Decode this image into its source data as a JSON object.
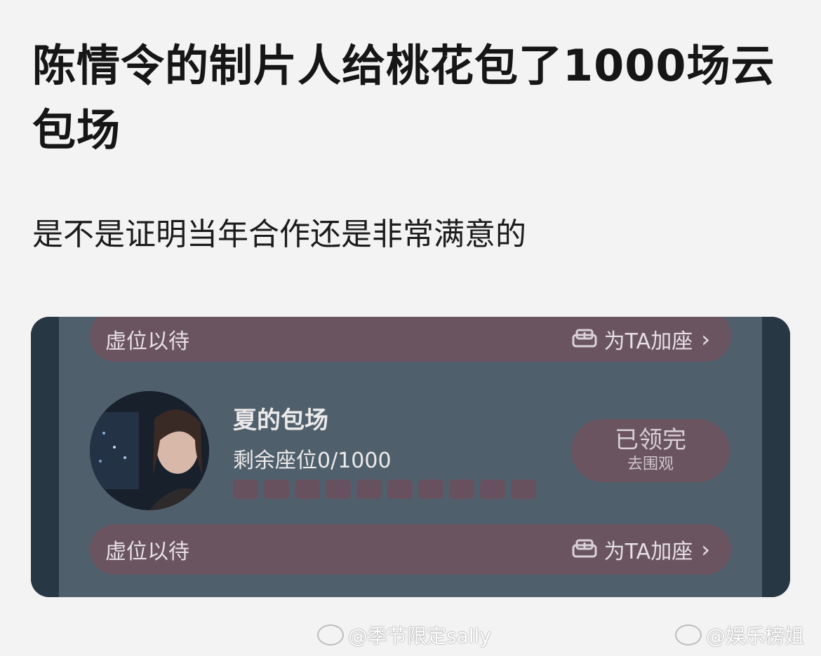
{
  "post": {
    "title": "陈情令的制片人给桃花包了1000场云包场",
    "body": "是不是证明当年合作还是非常满意的"
  },
  "card": {
    "top_row": {
      "label": "虚位以待",
      "action": "为TA加座"
    },
    "room": {
      "name": "夏的包场",
      "seats": "剩余座位0/1000",
      "seat_slots_shown": 10
    },
    "claimed_button": {
      "main": "已领完",
      "sub": "去围观"
    },
    "bottom_row": {
      "label": "虚位以待",
      "action": "为TA加座"
    }
  },
  "watermarks": [
    "@季节限定sally",
    "@娱乐榜姐"
  ],
  "icons": {
    "add_seat": "sofa-plus-icon",
    "chevron": "chevron-right-icon",
    "watermark_logo": "weibo-icon"
  },
  "colors": {
    "card_bg": "#4f606c",
    "pill_bg": "#6a5460",
    "edge": "#283744"
  }
}
